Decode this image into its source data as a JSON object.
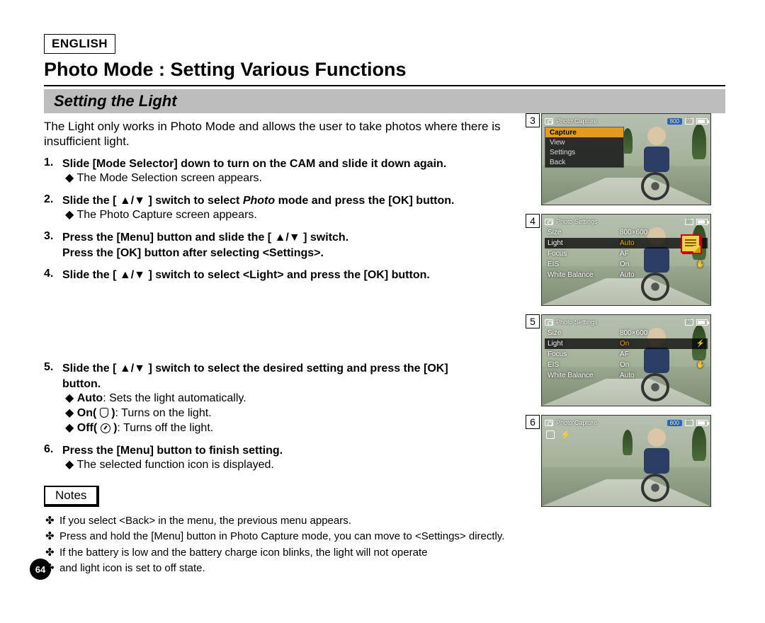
{
  "lang": "ENGLISH",
  "title": "Photo Mode : Setting Various Functions",
  "section": "Setting the Light",
  "intro": "The Light only works in Photo Mode and allows the user to take photos where there is insufficient light.",
  "steps": {
    "s1_head": "Slide [Mode Selector] down to turn on the CAM and slide it down again.",
    "s1_sub": "The Mode Selection screen appears.",
    "s2_head_a": "Slide the [ ▲/▼ ] switch to select ",
    "s2_head_ital": "Photo",
    "s2_head_b": " mode and press the [OK] button.",
    "s2_sub": "The Photo Capture screen appears.",
    "s3_head": "Press the [Menu] button and slide the [ ▲/▼ ] switch.\nPress the [OK] button after selecting <Settings>.",
    "s4_head": "Slide the [ ▲/▼ ] switch to select <Light> and press the [OK] button.",
    "s5_head": "Slide the [ ▲/▼ ] switch to select the desired setting and press the [OK] button.",
    "s5_o1": "Auto",
    "s5_o1d": ": Sets the light automatically.",
    "s5_o2": "On(",
    "s5_o2d": ": Turns on the light.",
    "s5_o3": "Off(",
    "s5_o3d": ": Turns off the light.",
    "s6_head": "Press the [Menu] button to finish setting.",
    "s6_sub": "The selected function icon is displayed."
  },
  "notes_label": "Notes",
  "notes": {
    "n1": "If you select <Back> in the menu, the previous menu appears.",
    "n2": "Press and hold the [Menu] button in Photo Capture mode, you can move to <Settings> directly.",
    "n3": "If the battery is low and the battery charge icon blinks, the light will not operate",
    "n4": "and light icon is set to off state."
  },
  "page_number": "64",
  "shots": {
    "s3": {
      "num": "3",
      "header": "Photo Capture",
      "pill": "800",
      "menu": [
        "Capture",
        "View",
        "Settings",
        "Back"
      ],
      "menu_sel": 0
    },
    "s4": {
      "num": "4",
      "header": "Photo Settings",
      "rows": [
        {
          "lbl": "Size",
          "val": "800×600"
        },
        {
          "lbl": "Light",
          "val": "Auto"
        },
        {
          "lbl": "Focus",
          "val": "AF"
        },
        {
          "lbl": "EIS",
          "val": "On"
        },
        {
          "lbl": "White Balance",
          "val": "Auto"
        }
      ],
      "sel": 1,
      "sticker": true
    },
    "s5": {
      "num": "5",
      "header": "Photo Settings",
      "rows": [
        {
          "lbl": "Size",
          "val": "800×600"
        },
        {
          "lbl": "Light",
          "val": "On"
        },
        {
          "lbl": "Focus",
          "val": "AF"
        },
        {
          "lbl": "EIS",
          "val": "On"
        },
        {
          "lbl": "White Balance",
          "val": "Auto"
        }
      ],
      "sel": 1
    },
    "s6": {
      "num": "6",
      "header": "Photo Capture",
      "pill": "800",
      "icons": true
    }
  }
}
